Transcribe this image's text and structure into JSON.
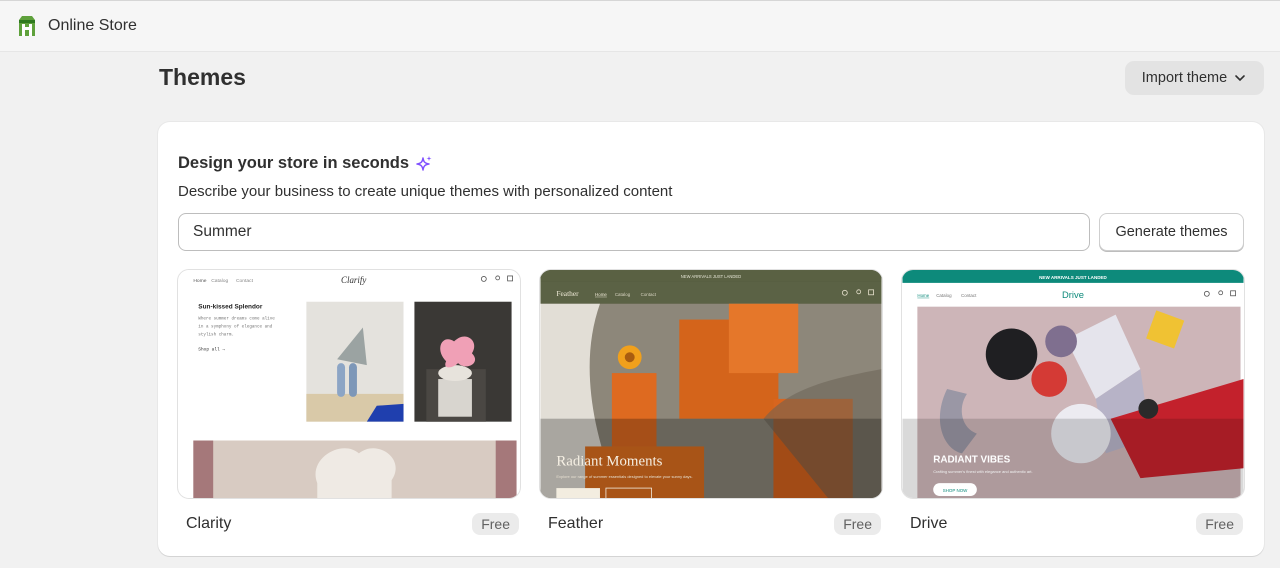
{
  "app": {
    "title": "Online Store",
    "logo_icon": "shop-bag-icon",
    "accent": "#5fa13c"
  },
  "header": {
    "title": "Themes",
    "import_label": "Import theme"
  },
  "design": {
    "title": "Design your store in seconds",
    "sparkle_color": "#8051ff",
    "description": "Describe your business to create unique themes with personalized content",
    "input_value": "Summer",
    "generate_label": "Generate themes"
  },
  "themes": [
    {
      "name": "Clarity",
      "price": "Free",
      "preview": {
        "logo": "Clarify",
        "nav": [
          "Home",
          "Catalog",
          "Contact"
        ],
        "heading": "Sun-kissed Splendor",
        "body": [
          "Where summer dreams come alive",
          "in a symphony of elegance and",
          "stylish charm."
        ],
        "link": "Shop all →"
      }
    },
    {
      "name": "Feather",
      "price": "Free",
      "preview": {
        "announcement": "NEW ARRIVALS JUST LANDED",
        "logo": "Feather",
        "nav": [
          "Home",
          "Catalog",
          "Contact"
        ],
        "heading": "Radiant Moments",
        "body": "Explore our range of summer essentials designed to elevate your sunny days."
      }
    },
    {
      "name": "Drive",
      "price": "Free",
      "preview": {
        "announcement": "NEW ARRIVALS JUST LANDED",
        "logo": "Drive",
        "nav": [
          "Home",
          "Catalog",
          "Contact"
        ],
        "heading": "RADIANT VIBES",
        "body": "Crafting summer's finest with elegance and authentic art.",
        "cta": "SHOP NOW"
      }
    }
  ]
}
